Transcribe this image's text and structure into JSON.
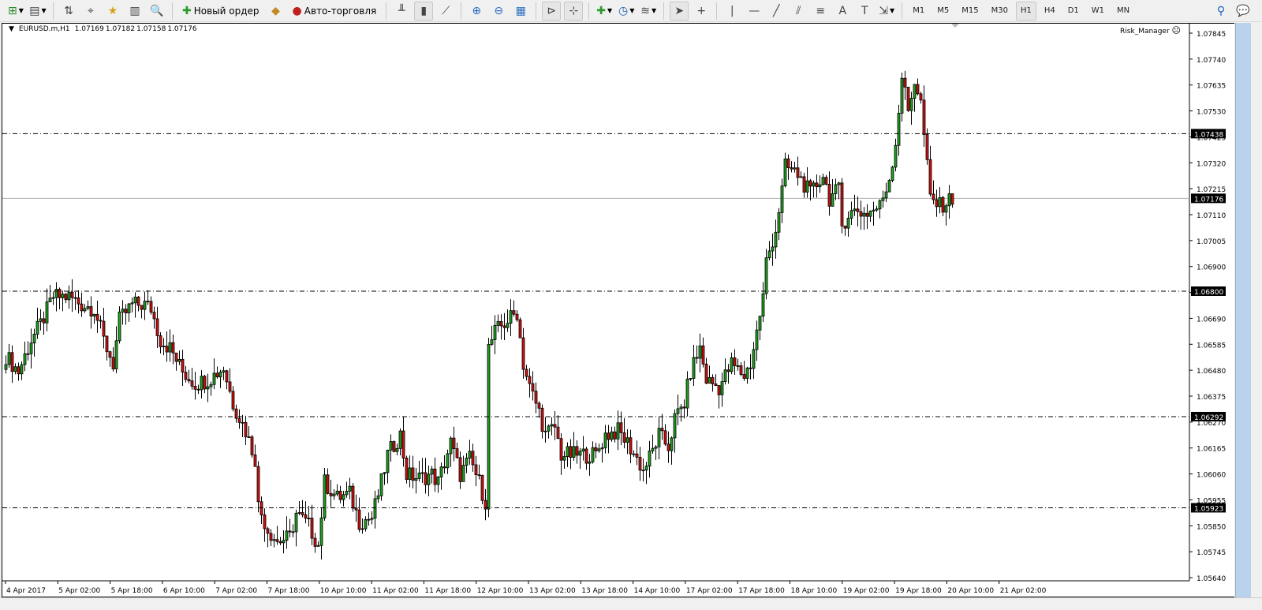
{
  "toolbar": {
    "items": [
      {
        "icon": "new-chart-icon",
        "dropdown": true
      },
      {
        "icon": "profiles-icon",
        "dropdown": true
      },
      {
        "sep": true
      },
      {
        "icon": "market-watch-icon"
      },
      {
        "icon": "data-window-icon"
      },
      {
        "icon": "navigator-icon"
      },
      {
        "icon": "terminal-icon"
      },
      {
        "icon": "strategy-tester-icon"
      },
      {
        "sep": true
      },
      {
        "icon": "new-order-icon",
        "label": "Новый ордер"
      },
      {
        "icon": "metaeditor-icon"
      },
      {
        "icon": "autotrading-icon",
        "label": "Авто-торговля"
      },
      {
        "sep": true
      },
      {
        "icon": "bar-chart-icon"
      },
      {
        "icon": "candlestick-chart-icon",
        "active": true
      },
      {
        "icon": "line-chart-icon"
      },
      {
        "sep": true
      },
      {
        "icon": "zoom-in-icon"
      },
      {
        "icon": "zoom-out-icon"
      },
      {
        "icon": "tile-windows-icon"
      },
      {
        "sep": true
      },
      {
        "icon": "auto-scroll-icon",
        "active": true
      },
      {
        "icon": "chart-shift-icon",
        "active": true
      },
      {
        "sep": true
      },
      {
        "icon": "indicators-icon",
        "dropdown": true
      },
      {
        "icon": "periods-icon",
        "dropdown": true
      },
      {
        "icon": "templates-icon",
        "dropdown": true
      },
      {
        "sep": true
      },
      {
        "icon": "cursor-icon",
        "active": true
      },
      {
        "icon": "crosshair-icon"
      },
      {
        "sep": true
      },
      {
        "icon": "vertical-line-icon"
      },
      {
        "icon": "horizontal-line-icon"
      },
      {
        "icon": "trendline-icon"
      },
      {
        "icon": "equidistant-channel-icon"
      },
      {
        "icon": "fibonacci-icon"
      },
      {
        "icon": "text-icon"
      },
      {
        "icon": "text-label-icon"
      },
      {
        "icon": "arrows-icon",
        "dropdown": true
      },
      {
        "sep": true
      }
    ],
    "glyphs": {
      "new-chart-icon": "⊞",
      "profiles-icon": "▤",
      "market-watch-icon": "⇅",
      "data-window-icon": "⌖",
      "navigator-icon": "★",
      "terminal-icon": "▥",
      "strategy-tester-icon": "🔍",
      "new-order-icon": "✚",
      "metaeditor-icon": "◆",
      "autotrading-icon": "●",
      "bar-chart-icon": "╨",
      "candlestick-chart-icon": "▮",
      "line-chart-icon": "⟋",
      "zoom-in-icon": "⊕",
      "zoom-out-icon": "⊖",
      "tile-windows-icon": "▦",
      "auto-scroll-icon": "⊳",
      "chart-shift-icon": "⊹",
      "indicators-icon": "✚",
      "periods-icon": "◷",
      "templates-icon": "≋",
      "cursor-icon": "➤",
      "crosshair-icon": "+",
      "vertical-line-icon": "|",
      "horizontal-line-icon": "—",
      "trendline-icon": "╱",
      "equidistant-channel-icon": "⫽",
      "fibonacci-icon": "≡",
      "text-icon": "A",
      "text-label-icon": "T",
      "arrows-icon": "⇲",
      "search-icon": "⚲",
      "chat-icon": "💬"
    },
    "timeframes": [
      "M1",
      "M5",
      "M15",
      "M30",
      "H1",
      "H4",
      "D1",
      "W1",
      "MN"
    ],
    "active_timeframe": "H1"
  },
  "chart": {
    "symbol": "EURUSD.m,H1",
    "open": "1.07169",
    "high": "1.07182",
    "low": "1.07158",
    "close": "1.07176",
    "expert": "Risk_Manager",
    "expert_status_icon": "sad-face-icon",
    "bull_color": "#1fa01f",
    "bear_color": "#d01010",
    "price_ticks": [
      "1.07845",
      "1.07740",
      "1.07635",
      "1.07530",
      "1.07425",
      "1.07320",
      "1.07215",
      "1.07110",
      "1.07005",
      "1.06900",
      "1.06795",
      "1.06690",
      "1.06585",
      "1.06480",
      "1.06375",
      "1.06270",
      "1.06165",
      "1.06060",
      "1.05955",
      "1.05850",
      "1.05745",
      "1.05640"
    ],
    "time_ticks": [
      "4 Apr 2017",
      "5 Apr 02:00",
      "5 Apr 18:00",
      "6 Apr 10:00",
      "7 Apr 02:00",
      "7 Apr 18:00",
      "10 Apr 10:00",
      "11 Apr 02:00",
      "11 Apr 18:00",
      "12 Apr 10:00",
      "13 Apr 02:00",
      "13 Apr 18:00",
      "14 Apr 10:00",
      "17 Apr 02:00",
      "17 Apr 18:00",
      "18 Apr 10:00",
      "19 Apr 02:00",
      "19 Apr 18:00",
      "20 Apr 10:00",
      "21 Apr 02:00"
    ],
    "hlines": [
      "1.07438",
      "1.06800",
      "1.06292",
      "1.05923"
    ],
    "bid_line": "1.07176"
  },
  "chart_data": {
    "type": "candlestick",
    "title": "EURUSD.m,H1",
    "ylim": [
      1.0564,
      1.07845
    ],
    "close_path_note": "approximate close prices at bar index (H1 bars from 4 Apr 2017)",
    "close_anchors": [
      [
        0,
        1.06538
      ],
      [
        4,
        1.06474
      ],
      [
        8,
        1.06602
      ],
      [
        11,
        1.06666
      ],
      [
        15,
        1.06778
      ],
      [
        20,
        1.06778
      ],
      [
        24,
        1.06746
      ],
      [
        28,
        1.0673
      ],
      [
        31,
        1.06602
      ],
      [
        34,
        1.06506
      ],
      [
        36,
        1.06682
      ],
      [
        40,
        1.06746
      ],
      [
        44,
        1.06746
      ],
      [
        46,
        1.0673
      ],
      [
        49,
        1.06602
      ],
      [
        52,
        1.0657
      ],
      [
        56,
        1.06474
      ],
      [
        60,
        1.06426
      ],
      [
        64,
        1.06442
      ],
      [
        69,
        1.0649
      ],
      [
        72,
        1.06346
      ],
      [
        76,
        1.06234
      ],
      [
        79,
        1.06122
      ],
      [
        80,
        1.05931
      ],
      [
        83,
        1.05835
      ],
      [
        86,
        1.05787
      ],
      [
        90,
        1.05803
      ],
      [
        92,
        1.05899
      ],
      [
        96,
        1.05851
      ],
      [
        99,
        1.05771
      ],
      [
        101,
        1.06026
      ],
      [
        105,
        1.05963
      ],
      [
        109,
        1.05979
      ],
      [
        112,
        1.05867
      ],
      [
        116,
        1.05883
      ],
      [
        119,
        1.06026
      ],
      [
        121,
        1.06138
      ],
      [
        125,
        1.06218
      ],
      [
        127,
        1.06058
      ],
      [
        131,
        1.06042
      ],
      [
        135,
        1.06058
      ],
      [
        137,
        1.06026
      ],
      [
        141,
        1.06186
      ],
      [
        144,
        1.06058
      ],
      [
        147,
        1.06122
      ],
      [
        150,
        1.06026
      ],
      [
        152,
        1.05947
      ],
      [
        153,
        1.0657
      ],
      [
        155,
        1.06634
      ],
      [
        159,
        1.06682
      ],
      [
        162,
        1.06714
      ],
      [
        164,
        1.06506
      ],
      [
        166,
        1.0641
      ],
      [
        169,
        1.06314
      ],
      [
        171,
        1.06218
      ],
      [
        174,
        1.0625
      ],
      [
        176,
        1.06138
      ],
      [
        184,
        1.06138
      ],
      [
        187,
        1.06138
      ],
      [
        190,
        1.06218
      ],
      [
        194,
        1.06234
      ],
      [
        197,
        1.06186
      ],
      [
        200,
        1.06122
      ],
      [
        202,
        1.06074
      ],
      [
        205,
        1.06154
      ],
      [
        207,
        1.06218
      ],
      [
        210,
        1.0617
      ],
      [
        212,
        1.06282
      ],
      [
        215,
        1.06346
      ],
      [
        217,
        1.06474
      ],
      [
        220,
        1.0657
      ],
      [
        222,
        1.06442
      ],
      [
        226,
        1.0641
      ],
      [
        230,
        1.06506
      ],
      [
        234,
        1.06458
      ],
      [
        236,
        1.06506
      ],
      [
        238,
        1.06634
      ],
      [
        240,
        1.06778
      ],
      [
        241,
        1.06921
      ],
      [
        244,
        1.07049
      ],
      [
        246,
        1.07209
      ],
      [
        247,
        1.07305
      ],
      [
        251,
        1.07273
      ],
      [
        255,
        1.07193
      ],
      [
        259,
        1.07273
      ],
      [
        261,
        1.07177
      ],
      [
        264,
        1.07209
      ],
      [
        265,
        1.07065
      ],
      [
        267,
        1.07113
      ],
      [
        270,
        1.07129
      ],
      [
        272,
        1.07113
      ],
      [
        275,
        1.07129
      ],
      [
        277,
        1.07145
      ],
      [
        280,
        1.07257
      ],
      [
        282,
        1.07401
      ],
      [
        284,
        1.07672
      ],
      [
        286,
        1.07529
      ],
      [
        288,
        1.07656
      ],
      [
        290,
        1.07561
      ],
      [
        291,
        1.07433
      ],
      [
        293,
        1.07177
      ],
      [
        296,
        1.07145
      ],
      [
        300,
        1.07176
      ]
    ]
  }
}
